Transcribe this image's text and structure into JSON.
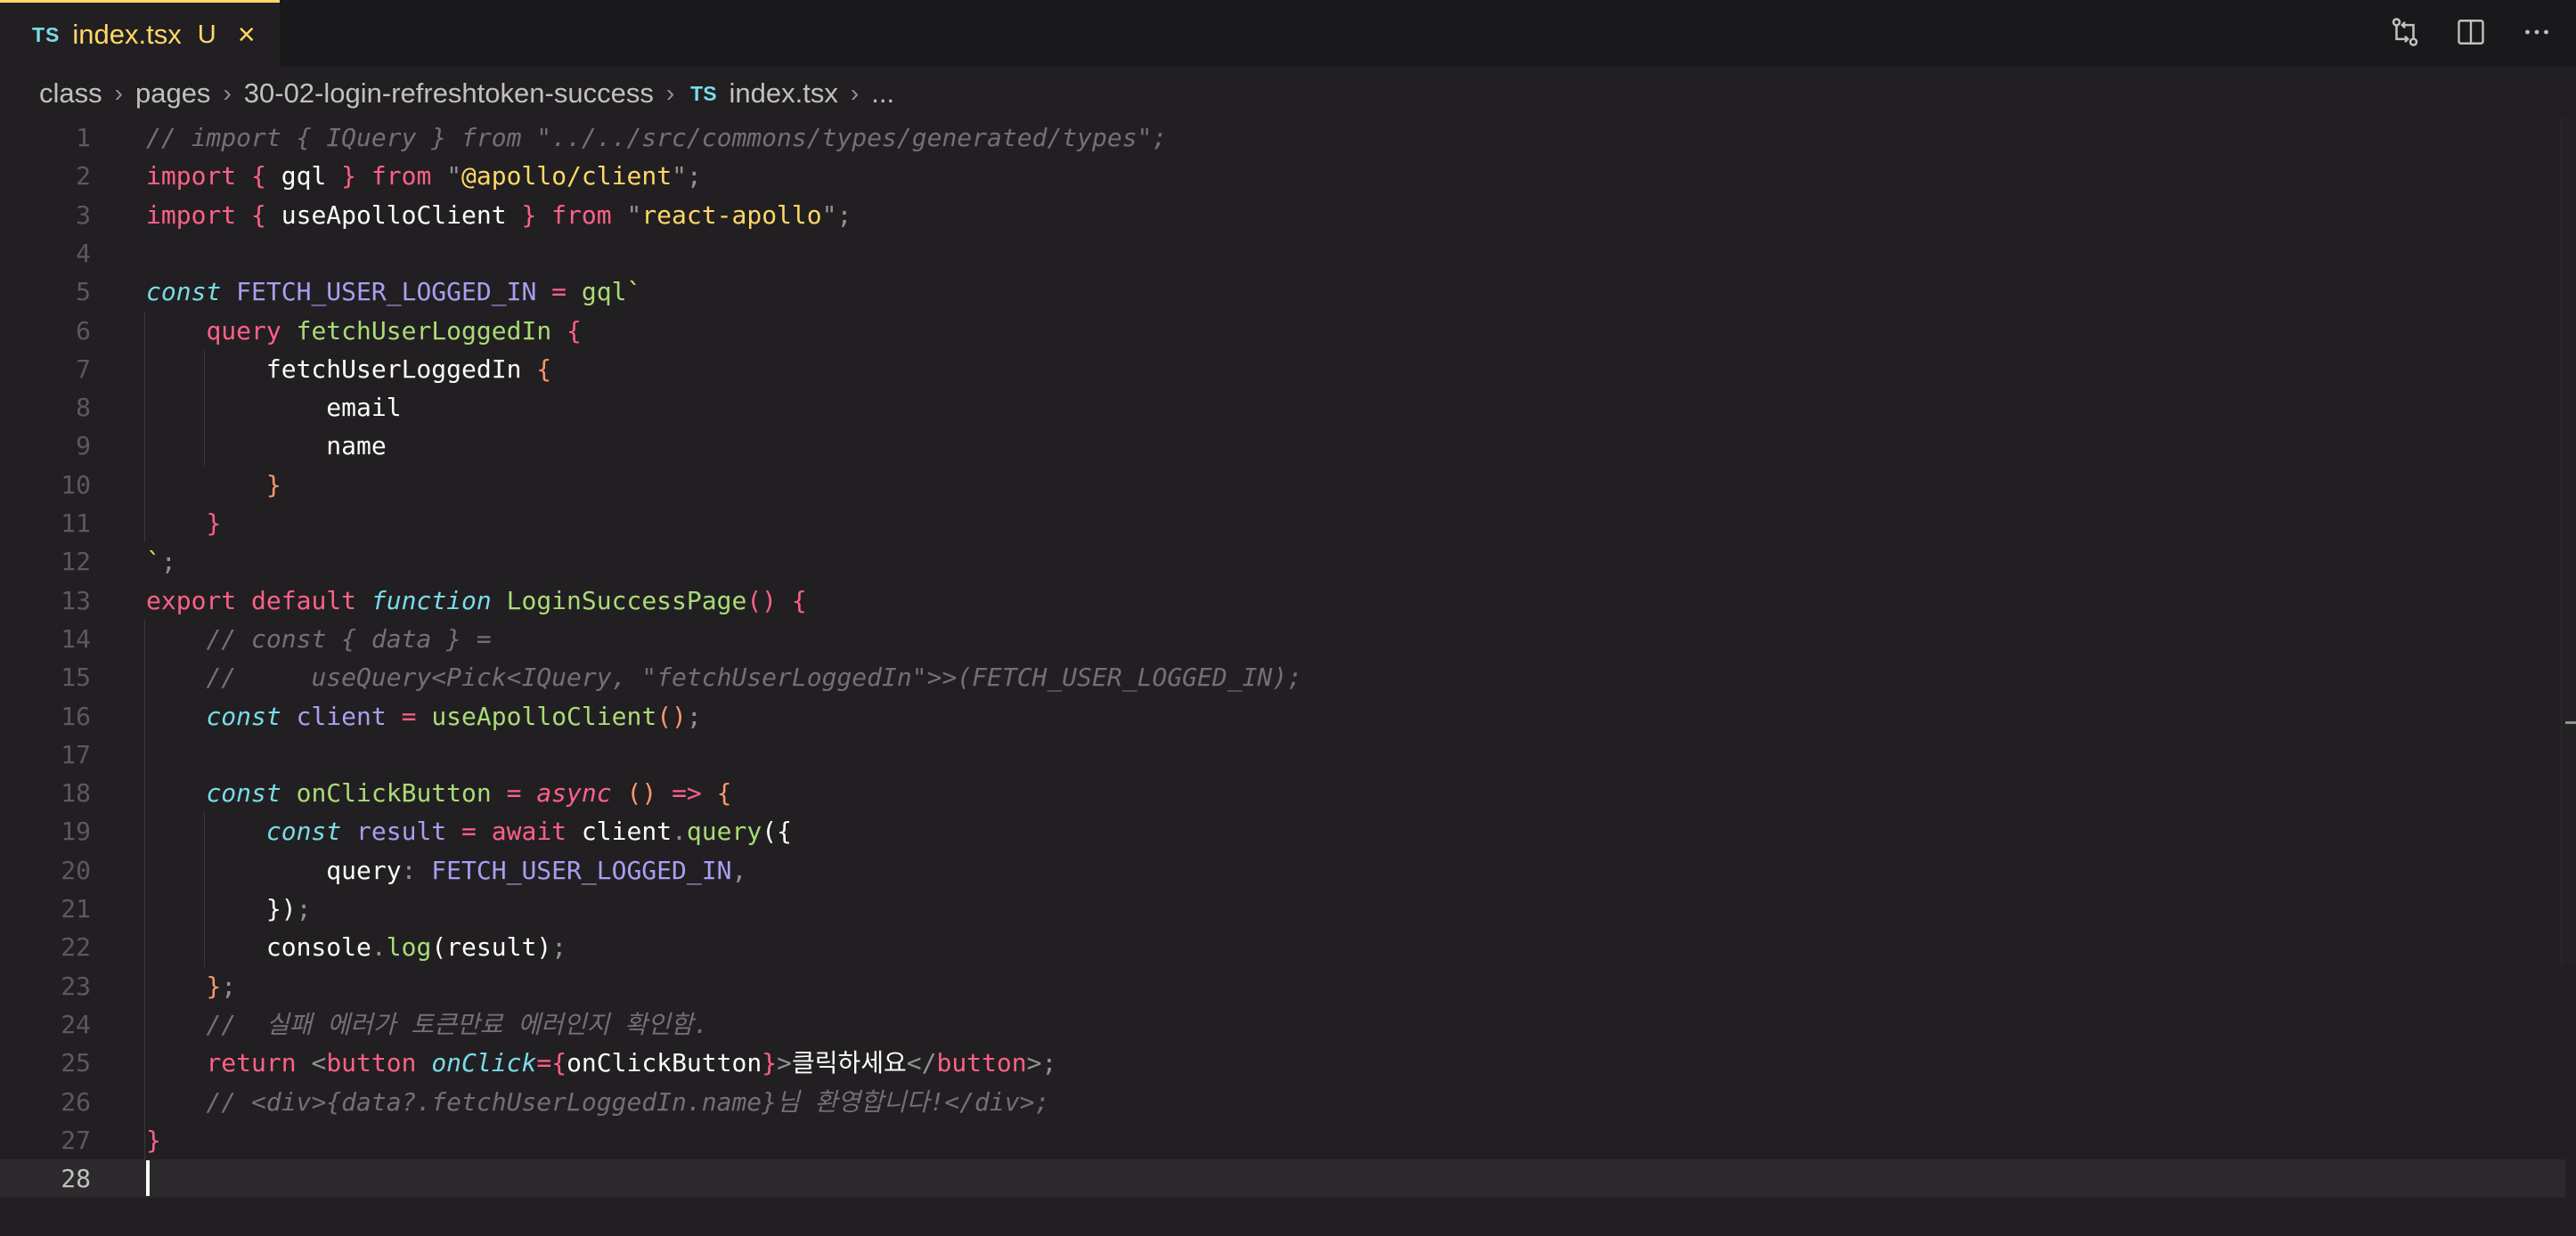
{
  "tab": {
    "lang": "TS",
    "filename": "index.tsx",
    "status": "U"
  },
  "breadcrumb": {
    "items": [
      "class",
      "pages",
      "30-02-login-refreshtoken-success"
    ],
    "file_lang": "TS",
    "file": "index.tsx",
    "more": "..."
  },
  "actions": [
    "source-control-compare-icon",
    "split-editor-icon",
    "more-actions-icon"
  ],
  "editor": {
    "current_line": 28,
    "lines": [
      [
        [
          "c-comment",
          "// import { IQuery } from \"../../src/commons/types/generated/types\";"
        ]
      ],
      [
        [
          "c-kw",
          "import"
        ],
        [
          "c-plain",
          " "
        ],
        [
          "c-brace2",
          "{"
        ],
        [
          "c-plain",
          " gql "
        ],
        [
          "c-brace2",
          "}"
        ],
        [
          "c-plain",
          " "
        ],
        [
          "c-kw",
          "from"
        ],
        [
          "c-plain",
          " "
        ],
        [
          "c-strq",
          "\""
        ],
        [
          "c-str",
          "@apollo/client"
        ],
        [
          "c-strq",
          "\""
        ],
        [
          "c-punc",
          ";"
        ]
      ],
      [
        [
          "c-kw",
          "import"
        ],
        [
          "c-plain",
          " "
        ],
        [
          "c-brace2",
          "{"
        ],
        [
          "c-plain",
          " useApolloClient "
        ],
        [
          "c-brace2",
          "}"
        ],
        [
          "c-plain",
          " "
        ],
        [
          "c-kw",
          "from"
        ],
        [
          "c-plain",
          " "
        ],
        [
          "c-strq",
          "\""
        ],
        [
          "c-str",
          "react-apollo"
        ],
        [
          "c-strq",
          "\""
        ],
        [
          "c-punc",
          ";"
        ]
      ],
      [],
      [
        [
          "c-kwi",
          "const"
        ],
        [
          "c-plain",
          " "
        ],
        [
          "c-var",
          "FETCH_USER_LOGGED_IN"
        ],
        [
          "c-plain",
          " "
        ],
        [
          "c-kw",
          "="
        ],
        [
          "c-plain",
          " "
        ],
        [
          "c-fn",
          "gql"
        ],
        [
          "c-tmpl",
          "`"
        ]
      ],
      [
        [
          "c-plain",
          "    "
        ],
        [
          "c-kw",
          "query"
        ],
        [
          "c-plain",
          " "
        ],
        [
          "c-fn",
          "fetchUserLoggedIn"
        ],
        [
          "c-plain",
          " "
        ],
        [
          "c-brace2",
          "{"
        ]
      ],
      [
        [
          "c-plain",
          "        fetchUserLoggedIn "
        ],
        [
          "c-brace",
          "{"
        ]
      ],
      [
        [
          "c-plain",
          "            email"
        ]
      ],
      [
        [
          "c-plain",
          "            name"
        ]
      ],
      [
        [
          "c-plain",
          "        "
        ],
        [
          "c-brace",
          "}"
        ]
      ],
      [
        [
          "c-plain",
          "    "
        ],
        [
          "c-brace2",
          "}"
        ]
      ],
      [
        [
          "c-tmpl",
          "`"
        ],
        [
          "c-punc",
          ";"
        ]
      ],
      [
        [
          "c-kw",
          "export"
        ],
        [
          "c-plain",
          " "
        ],
        [
          "c-kw",
          "default"
        ],
        [
          "c-plain",
          " "
        ],
        [
          "c-kwi",
          "function"
        ],
        [
          "c-plain",
          " "
        ],
        [
          "c-fn",
          "LoginSuccessPage"
        ],
        [
          "c-brace2",
          "()"
        ],
        [
          "c-plain",
          " "
        ],
        [
          "c-brace2",
          "{"
        ]
      ],
      [
        [
          "c-plain",
          "    "
        ],
        [
          "c-comment",
          "// const { data } ="
        ]
      ],
      [
        [
          "c-plain",
          "    "
        ],
        [
          "c-comment",
          "//     useQuery<Pick<IQuery, \"fetchUserLoggedIn\">>(FETCH_USER_LOGGED_IN);"
        ]
      ],
      [
        [
          "c-plain",
          "    "
        ],
        [
          "c-kwi",
          "const"
        ],
        [
          "c-plain",
          " "
        ],
        [
          "c-var",
          "client"
        ],
        [
          "c-plain",
          " "
        ],
        [
          "c-kw",
          "="
        ],
        [
          "c-plain",
          " "
        ],
        [
          "c-fn",
          "useApolloClient"
        ],
        [
          "c-brace",
          "()"
        ],
        [
          "c-punc",
          ";"
        ]
      ],
      [],
      [
        [
          "c-plain",
          "    "
        ],
        [
          "c-kwi",
          "const"
        ],
        [
          "c-plain",
          " "
        ],
        [
          "c-fn",
          "onClickButton"
        ],
        [
          "c-plain",
          " "
        ],
        [
          "c-kw",
          "="
        ],
        [
          "c-plain",
          " "
        ],
        [
          "c-async",
          "async"
        ],
        [
          "c-plain",
          " "
        ],
        [
          "c-brace",
          "()"
        ],
        [
          "c-plain",
          " "
        ],
        [
          "c-kw",
          "=>"
        ],
        [
          "c-plain",
          " "
        ],
        [
          "c-brace",
          "{"
        ]
      ],
      [
        [
          "c-plain",
          "        "
        ],
        [
          "c-kwi",
          "const"
        ],
        [
          "c-plain",
          " "
        ],
        [
          "c-var",
          "result"
        ],
        [
          "c-plain",
          " "
        ],
        [
          "c-kw",
          "="
        ],
        [
          "c-plain",
          " "
        ],
        [
          "c-kw",
          "await"
        ],
        [
          "c-plain",
          " client"
        ],
        [
          "c-punc",
          "."
        ],
        [
          "c-fn",
          "query"
        ],
        [
          "c-plain",
          "({"
        ]
      ],
      [
        [
          "c-plain",
          "            query"
        ],
        [
          "c-punc",
          ":"
        ],
        [
          "c-plain",
          " "
        ],
        [
          "c-var",
          "FETCH_USER_LOGGED_IN"
        ],
        [
          "c-punc",
          ","
        ]
      ],
      [
        [
          "c-plain",
          "        "
        ],
        [
          "c-plain",
          "})"
        ],
        [
          "c-punc",
          ";"
        ]
      ],
      [
        [
          "c-plain",
          "        console"
        ],
        [
          "c-punc",
          "."
        ],
        [
          "c-fn",
          "log"
        ],
        [
          "c-plain",
          "("
        ],
        [
          "c-plain",
          "result"
        ],
        [
          "c-plain",
          ")"
        ],
        [
          "c-punc",
          ";"
        ]
      ],
      [
        [
          "c-plain",
          "    "
        ],
        [
          "c-brace",
          "}"
        ],
        [
          "c-punc",
          ";"
        ]
      ],
      [
        [
          "c-plain",
          "    "
        ],
        [
          "c-comment",
          "//  실패 에러가 토큰만료 에러인지 확인함."
        ]
      ],
      [
        [
          "c-plain",
          "    "
        ],
        [
          "c-kw",
          "return"
        ],
        [
          "c-plain",
          " "
        ],
        [
          "c-punc",
          "<"
        ],
        [
          "c-tag",
          "button"
        ],
        [
          "c-plain",
          " "
        ],
        [
          "c-attr",
          "onClick"
        ],
        [
          "c-kw",
          "="
        ],
        [
          "c-brace2",
          "{"
        ],
        [
          "c-plain",
          "onClickButton"
        ],
        [
          "c-brace2",
          "}"
        ],
        [
          "c-punc",
          ">"
        ],
        [
          "c-plain",
          "클릭하세요"
        ],
        [
          "c-punc",
          "</"
        ],
        [
          "c-tag",
          "button"
        ],
        [
          "c-punc",
          ">;"
        ]
      ],
      [
        [
          "c-plain",
          "    "
        ],
        [
          "c-comment",
          "// <div>{data?.fetchUserLoggedIn.name}님 환영합니다!</div>;"
        ]
      ],
      [
        [
          "c-brace2",
          "}"
        ]
      ],
      []
    ]
  }
}
